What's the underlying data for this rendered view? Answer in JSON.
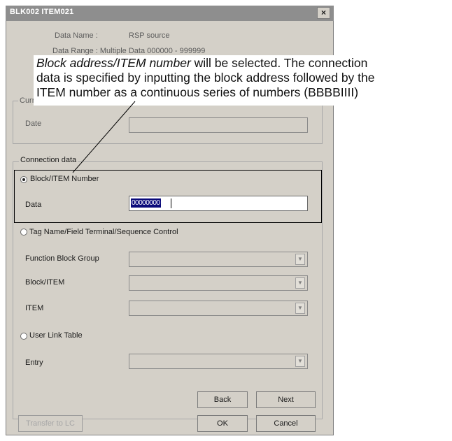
{
  "dialog": {
    "title": "BLK002 ITEM021",
    "close_label": "×",
    "data_name_label": "Data Name :",
    "data_name_value": "RSP source",
    "data_range_partial": "Data Range :   Multiple Data   000000 - 999999"
  },
  "first_group": {
    "title": "Current Setting",
    "data_label": "Date"
  },
  "connection": {
    "title": "Connection data",
    "block_item_option": "Block/ITEM Number",
    "data_label": "Data",
    "data_value": "00000000",
    "tag_option": "Tag Name/Field Terminal/Sequence Control",
    "function_block_group_label": "Function Block Group",
    "block_item_label": "Block/ITEM",
    "item_label": "ITEM",
    "user_link_option": "User Link Table",
    "entry_label": "Entry"
  },
  "buttons": {
    "back": "Back",
    "next": "Next",
    "ok": "OK",
    "cancel": "Cancel",
    "transfer": "Transfer to LC"
  },
  "annotation": {
    "italic_part": "Block address/ITEM number",
    "line1_rest": " will be selected. The connection",
    "line2": "data is specified by inputting the block address followed by the",
    "line3": "ITEM number as a continuous series of numbers (BBBBIIII)"
  },
  "icons": {
    "dropdown_glyph": "▼"
  }
}
